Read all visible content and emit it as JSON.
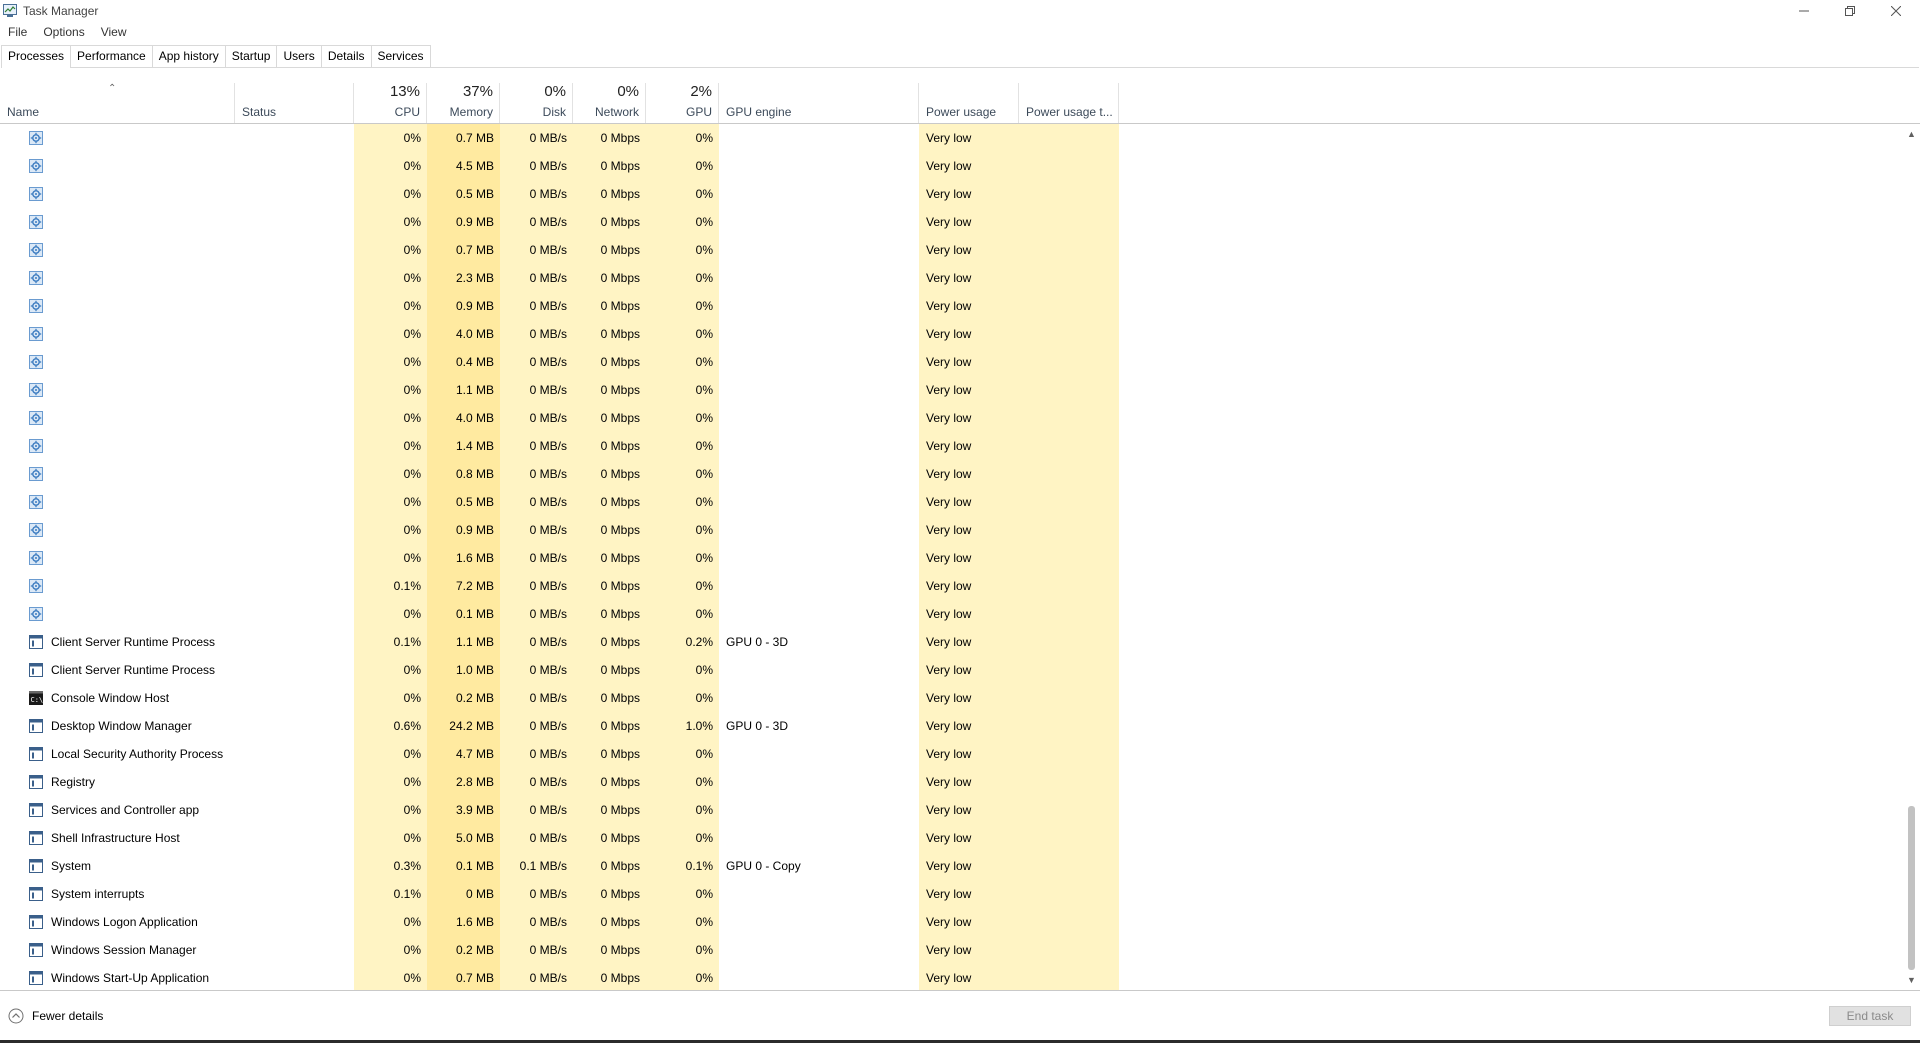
{
  "window": {
    "title": "Task Manager",
    "menu": [
      "File",
      "Options",
      "View"
    ],
    "tabs": [
      "Processes",
      "Performance",
      "App history",
      "Startup",
      "Users",
      "Details",
      "Services"
    ],
    "active_tab": "Processes"
  },
  "header": {
    "name": "Name",
    "status": "Status",
    "cpu_pct": "13%",
    "cpu": "CPU",
    "mem_pct": "37%",
    "mem": "Memory",
    "disk_pct": "0%",
    "disk": "Disk",
    "net_pct": "0%",
    "net": "Network",
    "gpu_pct": "2%",
    "gpu": "GPU",
    "gpu_engine": "GPU engine",
    "power": "Power usage",
    "power_trend": "Power usage t..."
  },
  "colors": {
    "heat_light": "#fff4c4",
    "heat_mid": "#ffeaa0",
    "header_text": "#3c4a5a",
    "service_icon": "#4a89c8"
  },
  "rows": [
    {
      "icon": "service-gear-icon",
      "name": "",
      "cpu": "0%",
      "mem": "0.7 MB",
      "disk": "0 MB/s",
      "net": "0 Mbps",
      "gpu": "0%",
      "engine": "",
      "power": "Very low"
    },
    {
      "icon": "service-gear-icon",
      "name": "",
      "cpu": "0%",
      "mem": "4.5 MB",
      "disk": "0 MB/s",
      "net": "0 Mbps",
      "gpu": "0%",
      "engine": "",
      "power": "Very low"
    },
    {
      "icon": "service-gear-icon",
      "name": "",
      "cpu": "0%",
      "mem": "0.5 MB",
      "disk": "0 MB/s",
      "net": "0 Mbps",
      "gpu": "0%",
      "engine": "",
      "power": "Very low"
    },
    {
      "icon": "service-gear-icon",
      "name": "",
      "cpu": "0%",
      "mem": "0.9 MB",
      "disk": "0 MB/s",
      "net": "0 Mbps",
      "gpu": "0%",
      "engine": "",
      "power": "Very low"
    },
    {
      "icon": "service-gear-icon",
      "name": "",
      "cpu": "0%",
      "mem": "0.7 MB",
      "disk": "0 MB/s",
      "net": "0 Mbps",
      "gpu": "0%",
      "engine": "",
      "power": "Very low"
    },
    {
      "icon": "service-gear-icon",
      "name": "",
      "cpu": "0%",
      "mem": "2.3 MB",
      "disk": "0 MB/s",
      "net": "0 Mbps",
      "gpu": "0%",
      "engine": "",
      "power": "Very low"
    },
    {
      "icon": "service-gear-icon",
      "name": "",
      "cpu": "0%",
      "mem": "0.9 MB",
      "disk": "0 MB/s",
      "net": "0 Mbps",
      "gpu": "0%",
      "engine": "",
      "power": "Very low"
    },
    {
      "icon": "service-gear-icon",
      "name": "",
      "cpu": "0%",
      "mem": "4.0 MB",
      "disk": "0 MB/s",
      "net": "0 Mbps",
      "gpu": "0%",
      "engine": "",
      "power": "Very low"
    },
    {
      "icon": "service-gear-icon",
      "name": "",
      "cpu": "0%",
      "mem": "0.4 MB",
      "disk": "0 MB/s",
      "net": "0 Mbps",
      "gpu": "0%",
      "engine": "",
      "power": "Very low"
    },
    {
      "icon": "service-gear-icon",
      "name": "",
      "cpu": "0%",
      "mem": "1.1 MB",
      "disk": "0 MB/s",
      "net": "0 Mbps",
      "gpu": "0%",
      "engine": "",
      "power": "Very low"
    },
    {
      "icon": "service-gear-icon",
      "name": "",
      "cpu": "0%",
      "mem": "4.0 MB",
      "disk": "0 MB/s",
      "net": "0 Mbps",
      "gpu": "0%",
      "engine": "",
      "power": "Very low"
    },
    {
      "icon": "service-gear-icon",
      "name": "",
      "cpu": "0%",
      "mem": "1.4 MB",
      "disk": "0 MB/s",
      "net": "0 Mbps",
      "gpu": "0%",
      "engine": "",
      "power": "Very low"
    },
    {
      "icon": "service-gear-icon",
      "name": "",
      "cpu": "0%",
      "mem": "0.8 MB",
      "disk": "0 MB/s",
      "net": "0 Mbps",
      "gpu": "0%",
      "engine": "",
      "power": "Very low"
    },
    {
      "icon": "service-gear-icon",
      "name": "",
      "cpu": "0%",
      "mem": "0.5 MB",
      "disk": "0 MB/s",
      "net": "0 Mbps",
      "gpu": "0%",
      "engine": "",
      "power": "Very low"
    },
    {
      "icon": "service-gear-icon",
      "name": "",
      "cpu": "0%",
      "mem": "0.9 MB",
      "disk": "0 MB/s",
      "net": "0 Mbps",
      "gpu": "0%",
      "engine": "",
      "power": "Very low"
    },
    {
      "icon": "service-gear-icon",
      "name": "",
      "cpu": "0%",
      "mem": "1.6 MB",
      "disk": "0 MB/s",
      "net": "0 Mbps",
      "gpu": "0%",
      "engine": "",
      "power": "Very low"
    },
    {
      "icon": "service-gear-icon",
      "name": "",
      "cpu": "0.1%",
      "mem": "7.2 MB",
      "disk": "0 MB/s",
      "net": "0 Mbps",
      "gpu": "0%",
      "engine": "",
      "power": "Very low"
    },
    {
      "icon": "service-gear-icon",
      "name": "",
      "cpu": "0%",
      "mem": "0.1 MB",
      "disk": "0 MB/s",
      "net": "0 Mbps",
      "gpu": "0%",
      "engine": "",
      "power": "Very low"
    },
    {
      "icon": "process-window-icon",
      "name": "Client Server Runtime Process",
      "cpu": "0.1%",
      "mem": "1.1 MB",
      "disk": "0 MB/s",
      "net": "0 Mbps",
      "gpu": "0.2%",
      "engine": "GPU 0 - 3D",
      "power": "Very low"
    },
    {
      "icon": "process-window-icon",
      "name": "Client Server Runtime Process",
      "cpu": "0%",
      "mem": "1.0 MB",
      "disk": "0 MB/s",
      "net": "0 Mbps",
      "gpu": "0%",
      "engine": "",
      "power": "Very low"
    },
    {
      "icon": "console-icon",
      "name": "Console Window Host",
      "cpu": "0%",
      "mem": "0.2 MB",
      "disk": "0 MB/s",
      "net": "0 Mbps",
      "gpu": "0%",
      "engine": "",
      "power": "Very low"
    },
    {
      "icon": "process-window-icon",
      "name": "Desktop Window Manager",
      "cpu": "0.6%",
      "mem": "24.2 MB",
      "disk": "0 MB/s",
      "net": "0 Mbps",
      "gpu": "1.0%",
      "engine": "GPU 0 - 3D",
      "power": "Very low"
    },
    {
      "icon": "process-window-icon",
      "name": "Local Security Authority Process",
      "cpu": "0%",
      "mem": "4.7 MB",
      "disk": "0 MB/s",
      "net": "0 Mbps",
      "gpu": "0%",
      "engine": "",
      "power": "Very low"
    },
    {
      "icon": "process-window-icon",
      "name": "Registry",
      "cpu": "0%",
      "mem": "2.8 MB",
      "disk": "0 MB/s",
      "net": "0 Mbps",
      "gpu": "0%",
      "engine": "",
      "power": "Very low"
    },
    {
      "icon": "process-window-icon",
      "name": "Services and Controller app",
      "cpu": "0%",
      "mem": "3.9 MB",
      "disk": "0 MB/s",
      "net": "0 Mbps",
      "gpu": "0%",
      "engine": "",
      "power": "Very low"
    },
    {
      "icon": "process-window-icon",
      "name": "Shell Infrastructure Host",
      "cpu": "0%",
      "mem": "5.0 MB",
      "disk": "0 MB/s",
      "net": "0 Mbps",
      "gpu": "0%",
      "engine": "",
      "power": "Very low"
    },
    {
      "icon": "process-window-icon",
      "name": "System",
      "cpu": "0.3%",
      "mem": "0.1 MB",
      "disk": "0.1 MB/s",
      "net": "0 Mbps",
      "gpu": "0.1%",
      "engine": "GPU 0 - Copy",
      "power": "Very low"
    },
    {
      "icon": "process-window-icon",
      "name": "System interrupts",
      "cpu": "0.1%",
      "mem": "0 MB",
      "disk": "0 MB/s",
      "net": "0 Mbps",
      "gpu": "0%",
      "engine": "",
      "power": "Very low"
    },
    {
      "icon": "process-window-icon",
      "name": "Windows Logon Application",
      "cpu": "0%",
      "mem": "1.6 MB",
      "disk": "0 MB/s",
      "net": "0 Mbps",
      "gpu": "0%",
      "engine": "",
      "power": "Very low"
    },
    {
      "icon": "process-window-icon",
      "name": "Windows Session Manager",
      "cpu": "0%",
      "mem": "0.2 MB",
      "disk": "0 MB/s",
      "net": "0 Mbps",
      "gpu": "0%",
      "engine": "",
      "power": "Very low"
    },
    {
      "icon": "process-window-icon",
      "name": "Windows Start-Up Application",
      "cpu": "0%",
      "mem": "0.7 MB",
      "disk": "0 MB/s",
      "net": "0 Mbps",
      "gpu": "0%",
      "engine": "",
      "power": "Very low"
    }
  ],
  "footer": {
    "fewer_details": "Fewer details",
    "end_task": "End task"
  }
}
